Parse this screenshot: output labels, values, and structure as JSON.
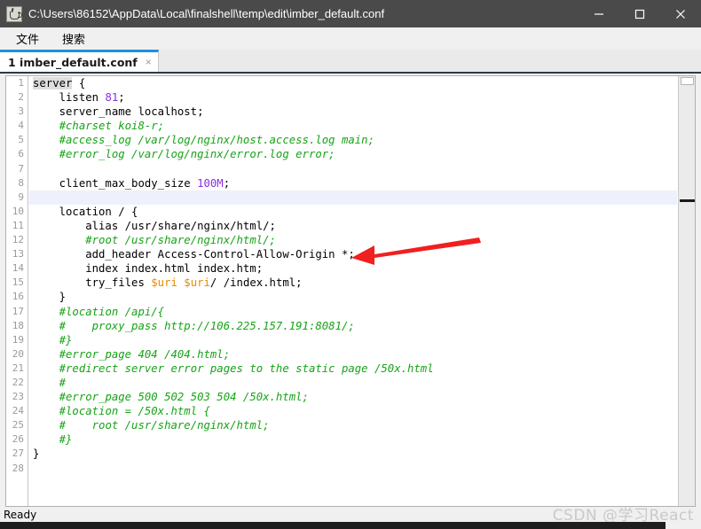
{
  "window": {
    "title": "C:\\Users\\86152\\AppData\\Local\\finalshell\\temp\\edit\\imber_default.conf",
    "icon": "java-app-icon",
    "minimize_label": "─",
    "maximize_label": "□",
    "close_label": "✕"
  },
  "menubar": {
    "items": [
      {
        "label": "文件"
      },
      {
        "label": "搜索"
      }
    ]
  },
  "tabs": [
    {
      "label": "1 imber_default.conf",
      "close_label": "×",
      "active": true
    }
  ],
  "editor": {
    "current_line": 9,
    "total_lines": 28,
    "line_numbers": [
      "1",
      "2",
      "3",
      "4",
      "5",
      "6",
      "7",
      "8",
      "9",
      "10",
      "11",
      "12",
      "13",
      "14",
      "15",
      "16",
      "17",
      "18",
      "19",
      "20",
      "21",
      "22",
      "23",
      "24",
      "25",
      "26",
      "27",
      "28"
    ],
    "lines": [
      {
        "n": 1,
        "text": "server {"
      },
      {
        "n": 2,
        "text": "    listen 81;"
      },
      {
        "n": 3,
        "text": "    server_name localhost;"
      },
      {
        "n": 4,
        "text": "    #charset koi8-r;"
      },
      {
        "n": 5,
        "text": "    #access_log /var/log/nginx/host.access.log main;"
      },
      {
        "n": 6,
        "text": "    #error_log /var/log/nginx/error.log error;"
      },
      {
        "n": 7,
        "text": ""
      },
      {
        "n": 8,
        "text": "    client_max_body_size 100M;"
      },
      {
        "n": 9,
        "text": ""
      },
      {
        "n": 10,
        "text": "    location / {"
      },
      {
        "n": 11,
        "text": "        alias /usr/share/nginx/html/;"
      },
      {
        "n": 12,
        "text": "        #root /usr/share/nginx/html/;"
      },
      {
        "n": 13,
        "text": "        add_header Access-Control-Allow-Origin *;"
      },
      {
        "n": 14,
        "text": "        index index.html index.htm;"
      },
      {
        "n": 15,
        "text": "        try_files $uri $uri/ /index.html;"
      },
      {
        "n": 16,
        "text": "    }"
      },
      {
        "n": 17,
        "text": "    #location /api/{"
      },
      {
        "n": 18,
        "text": "    #    proxy_pass http://106.225.157.191:8081/;"
      },
      {
        "n": 19,
        "text": "    #}"
      },
      {
        "n": 20,
        "text": "    #error_page 404 /404.html;"
      },
      {
        "n": 21,
        "text": "    #redirect server error pages to the static page /50x.html"
      },
      {
        "n": 22,
        "text": "    #"
      },
      {
        "n": 23,
        "text": "    #error_page 500 502 503 504 /50x.html;"
      },
      {
        "n": 24,
        "text": "    #location = /50x.html {"
      },
      {
        "n": 25,
        "text": "    #    root /usr/share/nginx/html;"
      },
      {
        "n": 26,
        "text": "    #}"
      },
      {
        "n": 27,
        "text": "}"
      },
      {
        "n": 28,
        "text": ""
      }
    ]
  },
  "statusbar": {
    "text": "Ready"
  },
  "watermark": {
    "text": "CSDN @学习React"
  },
  "annotation": {
    "type": "red-arrow",
    "color": "#f02020",
    "points_at_line": 13
  },
  "colors": {
    "titlebar_bg": "#4a4a4a",
    "tab_accent": "#1e90e0",
    "comment": "#17a317",
    "number": "#8a2be2",
    "variable": "#e38b00",
    "current_line_bg": "#eef1fb",
    "arrow": "#f02020"
  }
}
